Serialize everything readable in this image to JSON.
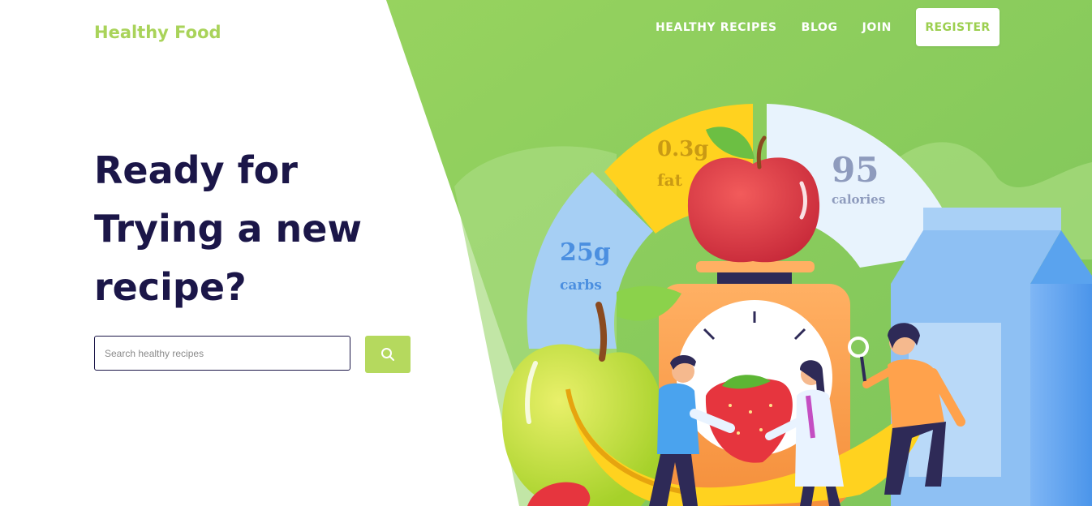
{
  "brand": {
    "logo_text": "Healthy Food"
  },
  "nav": {
    "items": [
      {
        "label": "HEALTHY RECIPES"
      },
      {
        "label": "BLOG"
      },
      {
        "label": "JOIN"
      }
    ],
    "register_label": "REGISTER"
  },
  "hero": {
    "headline_lines": [
      "Ready for",
      "Trying a new",
      "recipe?"
    ]
  },
  "search": {
    "placeholder": "Search healthy recipes",
    "value": "",
    "button_icon": "search-icon"
  },
  "nutrition": {
    "fat": {
      "amount": "0.3g",
      "label": "fat"
    },
    "calories": {
      "amount": "95",
      "label": "calories"
    },
    "carbs": {
      "amount": "25g",
      "label": "carbs"
    }
  },
  "colors": {
    "brand_green": "#a9d35a",
    "hero_green": "#8ccd5c",
    "headline_navy": "#1b1648",
    "search_button": "#b5d95e"
  }
}
